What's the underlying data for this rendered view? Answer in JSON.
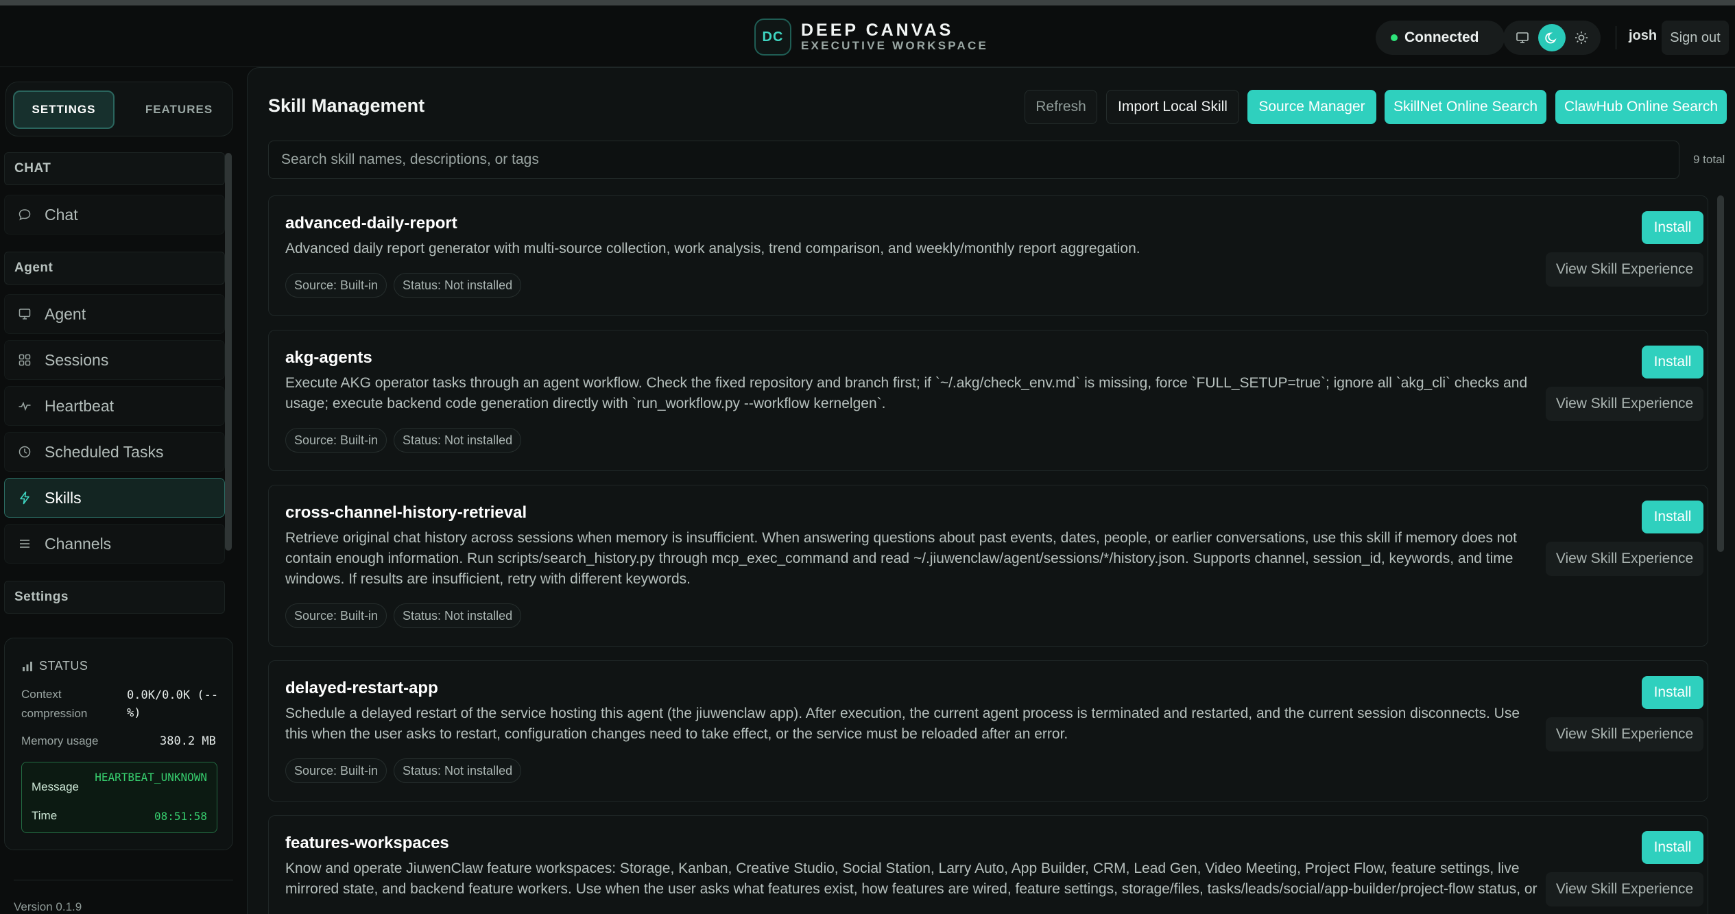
{
  "brand": {
    "logo": "DC",
    "name": "DEEP CANVAS",
    "subtitle": "EXECUTIVE WORKSPACE"
  },
  "header": {
    "connection": "Connected",
    "connection_color": "#2ee37a",
    "theme_icons": [
      "monitor-icon",
      "moon-icon",
      "sun-icon"
    ],
    "active_theme": "moon",
    "user": "josh",
    "sign_out": "Sign out"
  },
  "sidebar": {
    "tabs": [
      "SETTINGS",
      "FEATURES"
    ],
    "active_tab": "SETTINGS",
    "sections": [
      {
        "title": "CHAT",
        "items": [
          {
            "label": "Chat",
            "icon": "chat-bubble-icon"
          }
        ]
      },
      {
        "title": "Agent",
        "items": [
          {
            "label": "Agent",
            "icon": "monitor-icon"
          },
          {
            "label": "Sessions",
            "icon": "grid-icon"
          },
          {
            "label": "Heartbeat",
            "icon": "pulse-icon"
          },
          {
            "label": "Scheduled Tasks",
            "icon": "clock-icon"
          },
          {
            "label": "Skills",
            "icon": "lightning-icon",
            "active": true
          },
          {
            "label": "Channels",
            "icon": "lines-icon"
          }
        ]
      },
      {
        "title": "Settings",
        "items": []
      }
    ],
    "status": {
      "title": "STATUS",
      "context_label": "Context compression",
      "context_value": "0.0K/0.0K (--%)",
      "memory_label": "Memory usage",
      "memory_value": "380.2 MB",
      "message_label": "Message",
      "message_value": "HEARTBEAT_UNKNOWN",
      "time_label": "Time",
      "time_value": "08:51:58"
    },
    "version": "Version 0.1.9"
  },
  "main": {
    "title": "Skill Management",
    "toolbar": {
      "refresh": "Refresh",
      "import": "Import Local Skill",
      "source_manager": "Source Manager",
      "skillnet_search": "SkillNet Online Search",
      "clawhub_search": "ClawHub Online Search"
    },
    "search_placeholder": "Search skill names, descriptions, or tags",
    "total": "9 total",
    "install_label": "Install",
    "experience_label": "View Skill Experience",
    "accent_color": "#2fd0be",
    "skills": [
      {
        "name": "advanced-daily-report",
        "description": "Advanced daily report generator with multi-source collection, work analysis, trend comparison, and weekly/monthly report aggregation.",
        "source": "Source: Built-in",
        "status": "Status: Not installed"
      },
      {
        "name": "akg-agents",
        "description": "Execute AKG operator tasks through an agent workflow. Check the fixed repository and branch first; if `~/.akg/check_env.md` is missing, force `FULL_SETUP=true`; ignore all `akg_cli` checks and usage; execute backend code generation directly with `run_workflow.py --workflow kernelgen`.",
        "source": "Source: Built-in",
        "status": "Status: Not installed"
      },
      {
        "name": "cross-channel-history-retrieval",
        "description": "Retrieve original chat history across sessions when memory is insufficient. When answering questions about past events, dates, people, or earlier conversations, use this skill if memory does not contain enough information. Run scripts/search_history.py through mcp_exec_command and read ~/.jiuwenclaw/agent/sessions/*/history.json. Supports channel, session_id, keywords, and time windows. If results are insufficient, retry with different keywords.",
        "source": "Source: Built-in",
        "status": "Status: Not installed"
      },
      {
        "name": "delayed-restart-app",
        "description": "Schedule a delayed restart of the service hosting this agent (the jiuwenclaw app). After execution, the current agent process is terminated and restarted, and the current session disconnects. Use this when the user asks to restart, configuration changes need to take effect, or the service must be reloaded after an error.",
        "source": "Source: Built-in",
        "status": "Status: Not installed"
      },
      {
        "name": "features-workspaces",
        "description": "Know and operate JiuwenClaw feature workspaces: Storage, Kanban, Creative Studio, Social Station, Larry Auto, App Builder, CRM, Lead Gen, Video Meeting, Project Flow, feature settings, live mirrored state, and backend feature workers. Use when the user asks what features exist, how features are wired, feature settings, storage/files, tasks/leads/social/app-builder/project-flow status, or",
        "source": "Source: Built-in",
        "status": "Status: Not installed"
      }
    ]
  }
}
